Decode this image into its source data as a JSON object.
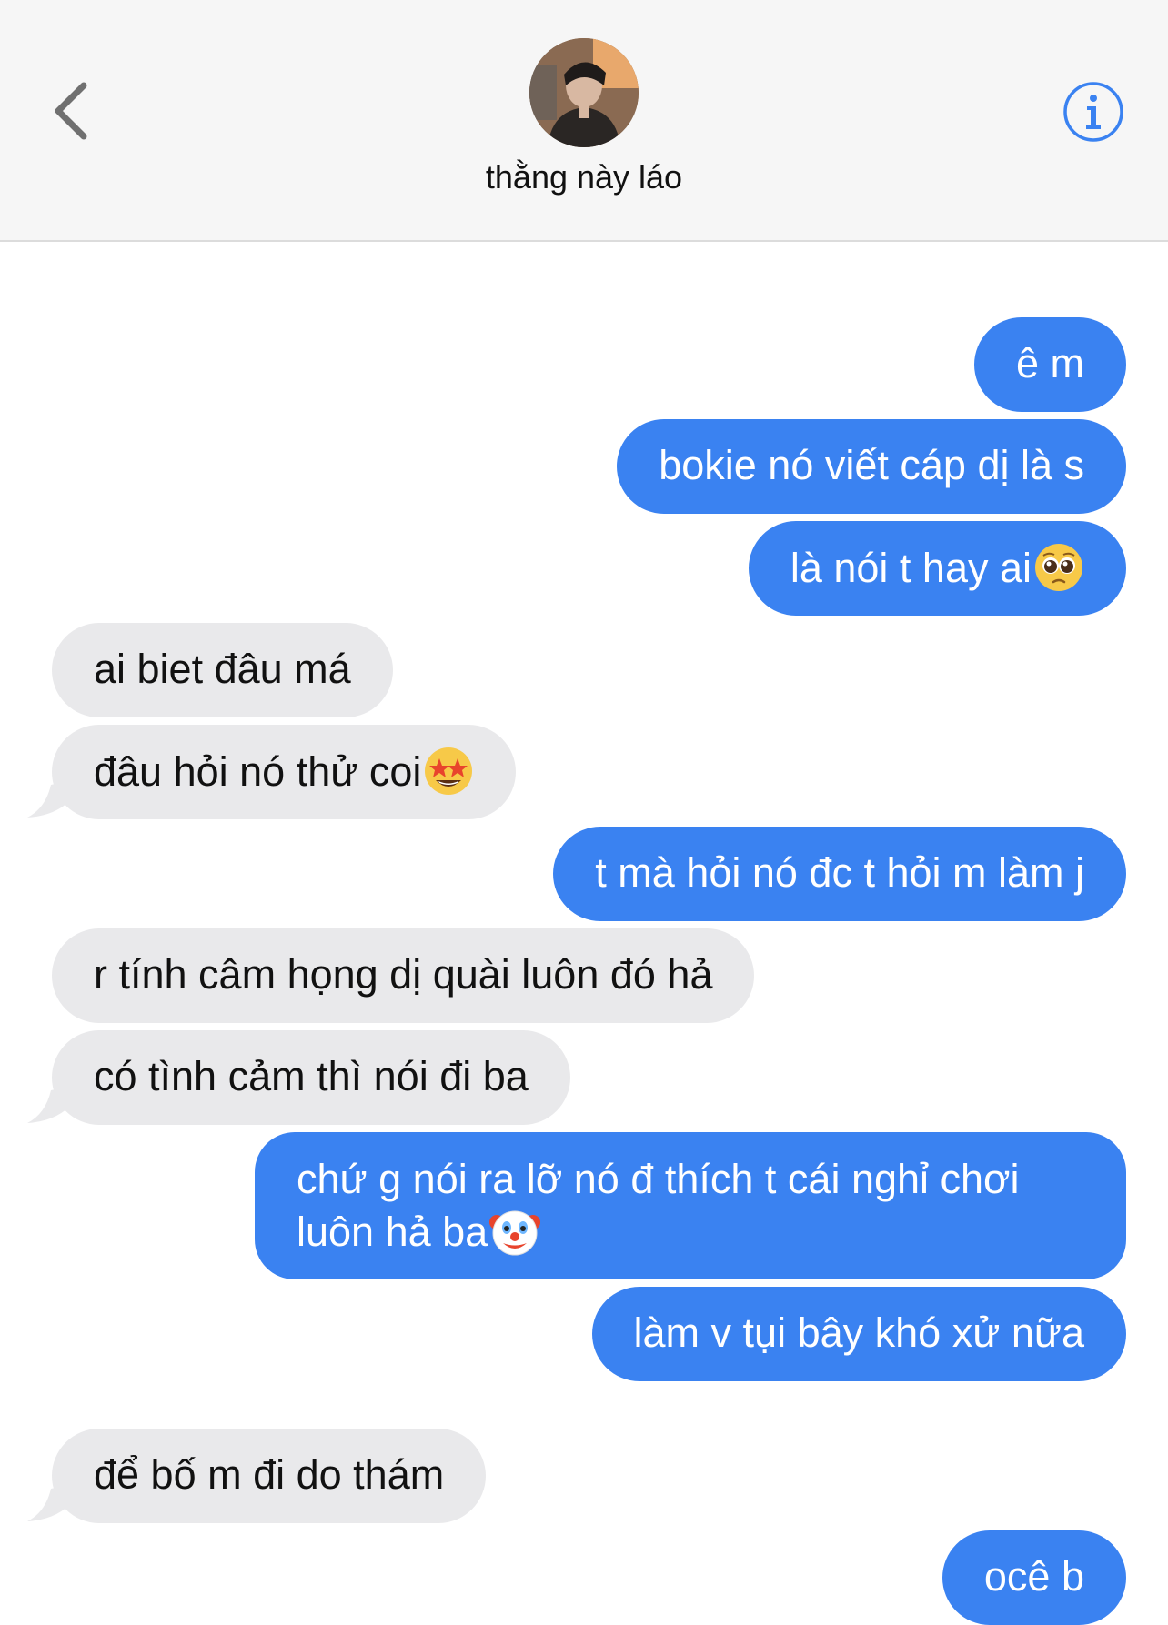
{
  "header": {
    "contact_name": "thằng này láo",
    "back_icon": "chevron-left-icon",
    "info_icon": "info-circle-icon",
    "accent": "#3a82f1"
  },
  "messages": [
    {
      "direction": "out",
      "text": "ê m"
    },
    {
      "direction": "out",
      "text": "bokie nó viết cáp dị là s"
    },
    {
      "direction": "out",
      "text": "là nói t hay ai",
      "emoji": "pleading-face-emoji"
    },
    {
      "direction": "in",
      "text": "ai biet đâu má"
    },
    {
      "direction": "in",
      "text": "đâu hỏi nó thử coi",
      "emoji": "star-struck-emoji"
    },
    {
      "direction": "out",
      "text": "t mà hỏi nó đc t hỏi m làm j"
    },
    {
      "direction": "in",
      "text": "r tính câm họng dị quài luôn đó hả"
    },
    {
      "direction": "in",
      "text": "có tình cảm thì nói đi ba"
    },
    {
      "direction": "out",
      "text": "chứ g nói ra lỡ nó đ thích t cái nghỉ chơi luôn hả ba",
      "emoji": "clown-face-emoji"
    },
    {
      "direction": "out",
      "text": "làm v tụi bây khó xử nữa"
    },
    {
      "direction": "in",
      "text": "để bố m đi do thám"
    },
    {
      "direction": "out",
      "text": "ocê b"
    }
  ],
  "colors": {
    "outgoing_bubble": "#3a82f1",
    "incoming_bubble": "#e9e9eb",
    "header_bg": "#f6f6f6"
  }
}
